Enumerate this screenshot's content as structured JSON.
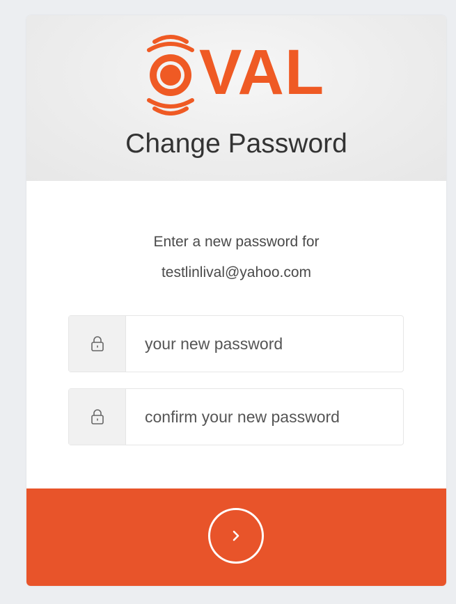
{
  "app": {
    "logo_text": "VAL",
    "brand_color": "#ef5a24"
  },
  "header": {
    "title": "Change Password"
  },
  "instructions": {
    "line1": "Enter a new password for",
    "email": "testlinlival@yahoo.com"
  },
  "fields": {
    "new_password": {
      "placeholder": "your new password",
      "value": "",
      "icon": "lock-icon"
    },
    "confirm_password": {
      "placeholder": "confirm your new password",
      "value": "",
      "icon": "lock-icon"
    }
  },
  "submit": {
    "icon": "chevron-right-icon",
    "color": "#e8542a"
  }
}
